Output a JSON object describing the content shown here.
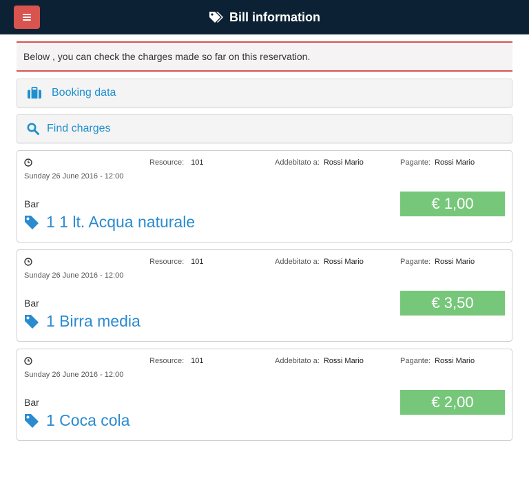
{
  "header": {
    "title": "Bill information",
    "icon": "tags-icon",
    "menu_icon": "hamburger-icon",
    "colors": {
      "background": "#0c2234",
      "menu_button": "#d9534f"
    }
  },
  "notice": {
    "text": "Below , you can check the charges made so far on this reservation.",
    "border_color": "#d9534f"
  },
  "panels": [
    {
      "label": "Booking data",
      "icon": "suitcase-icon"
    },
    {
      "label": "Find charges",
      "icon": "search-icon"
    }
  ],
  "labels": {
    "resource": "Resource:",
    "charged_to": "Addebitato a:",
    "payer": "Pagante:"
  },
  "charges": [
    {
      "date": "Sunday 26 June 2016 - 12:00",
      "resource": "101",
      "charged_to": "Rossi Mario",
      "payer": "Rossi Mario",
      "category": "Bar",
      "item": "1 1 lt. Acqua naturale",
      "price": "€ 1,00"
    },
    {
      "date": "Sunday 26 June 2016 - 12:00",
      "resource": "101",
      "charged_to": "Rossi Mario",
      "payer": "Rossi Mario",
      "category": "Bar",
      "item": "1 Birra media",
      "price": "€ 3,50"
    },
    {
      "date": "Sunday 26 June 2016 - 12:00",
      "resource": "101",
      "charged_to": "Rossi Mario",
      "payer": "Rossi Mario",
      "category": "Bar",
      "item": "1 Coca cola",
      "price": "€ 2,00"
    }
  ],
  "colors": {
    "accent": "#1e8fce",
    "price_badge": "#77c77a"
  }
}
